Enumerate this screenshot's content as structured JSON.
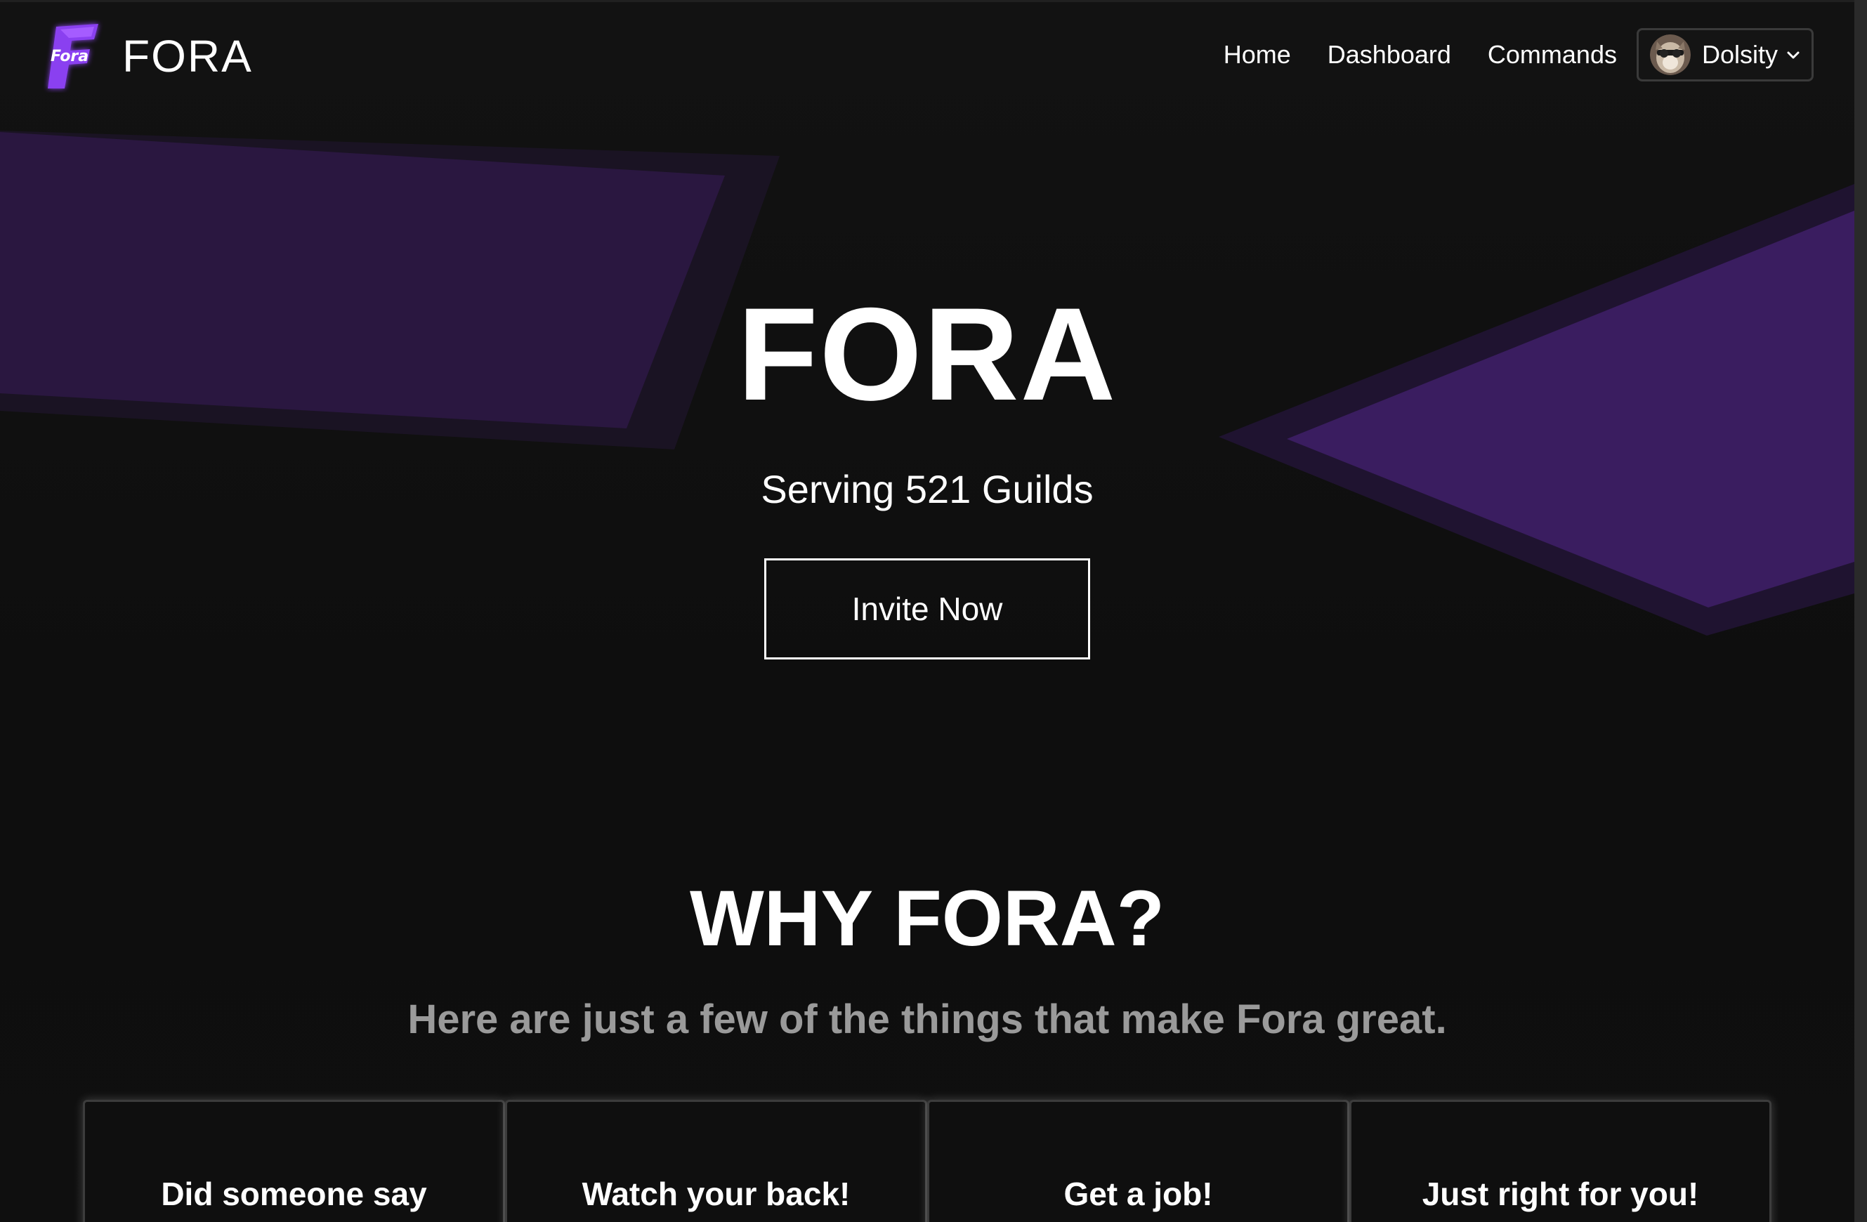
{
  "navbar": {
    "brand_name": "FORA",
    "logo_text": "Fora",
    "links": {
      "home": "Home",
      "dashboard": "Dashboard",
      "commands": "Commands"
    },
    "user": {
      "name": "Dolsity"
    }
  },
  "hero": {
    "title": "FORA",
    "subtitle": "Serving 521 Guilds",
    "invite_label": "Invite Now"
  },
  "why": {
    "title": "WHY FORA?",
    "subtitle": "Here are just a few of the things that make Fora great.",
    "cards": [
      {
        "title": "Did someone say"
      },
      {
        "title": "Watch your back!"
      },
      {
        "title": "Get a job!"
      },
      {
        "title": "Just right for you!"
      }
    ]
  },
  "colors": {
    "background": "#111111",
    "accent_purple": "#3b1f5e",
    "logo_purple": "#8a3ff0",
    "text": "#ffffff",
    "muted_text": "#9a9a9a"
  },
  "icons": {
    "logo": "fora-logo-icon",
    "avatar": "user-avatar",
    "dropdown": "chevron-down-icon"
  }
}
